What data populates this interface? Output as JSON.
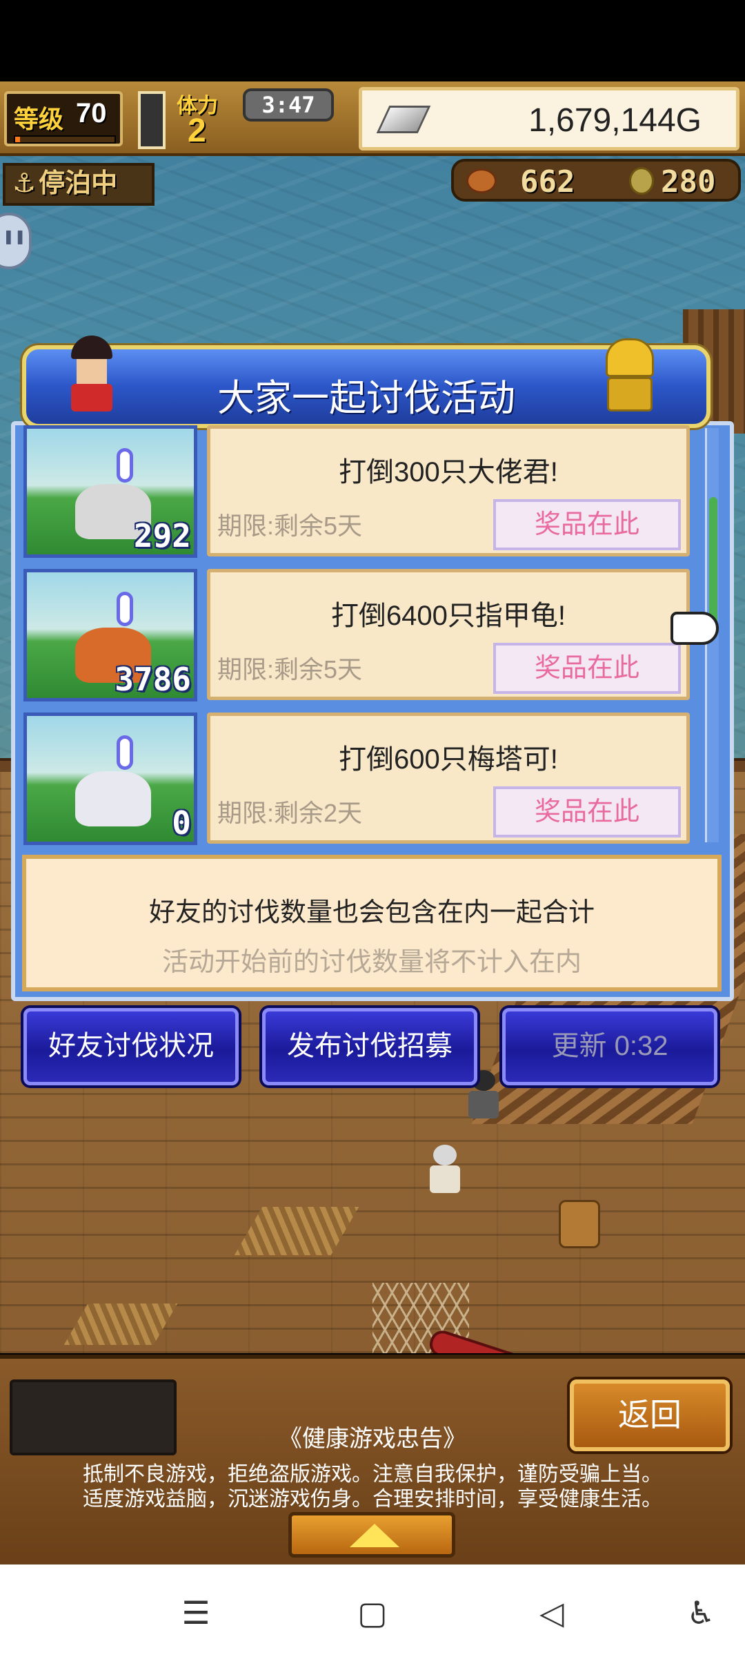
{
  "hud": {
    "level_label": "等级",
    "level_value": "70",
    "level_progress": 0.05,
    "stamina_label": "体力",
    "stamina_value": "2",
    "timer": "3:47",
    "gold": "1,679,144G",
    "status": "停泊中",
    "meat": "662",
    "coins": "280"
  },
  "panel": {
    "title": "大家一起讨伐活动",
    "events": [
      {
        "count": "292",
        "title": "打倒300只大佬君!",
        "deadline": "期限:剩余5天",
        "prize": "奖品在此",
        "monster": "squid",
        "color": "#d8d8d8"
      },
      {
        "count": "3786",
        "title": "打倒6400只指甲龟!",
        "deadline": "期限:剩余5天",
        "prize": "奖品在此",
        "monster": "turtle",
        "color": "#d86a2a"
      },
      {
        "count": "0",
        "title": "打倒600只梅塔可!",
        "deadline": "期限:剩余2天",
        "prize": "奖品在此",
        "monster": "cat",
        "color": "#e8e8f0"
      }
    ],
    "note_line1": "好友的讨伐数量也会包含在内一起合计",
    "note_line2": "活动开始前的讨伐数量将不计入在内"
  },
  "actions": {
    "friend_status": "好友讨伐状况",
    "publish_recruit": "发布讨伐招募",
    "refresh": "更新 0:32"
  },
  "footer": {
    "back": "返回",
    "advisory_title": "《健康游戏忠告》",
    "advisory_line1": "抵制不良游戏，拒绝盗版游戏。注意自我保护，谨防受骗上当。",
    "advisory_line2": "适度游戏益脑，沉迷游戏伤身。合理安排时间，享受健康生活。"
  },
  "navbar": {
    "menu_glyph": "☰",
    "home_glyph": "▢",
    "back_glyph": "◁",
    "accessibility_glyph": "♿"
  }
}
